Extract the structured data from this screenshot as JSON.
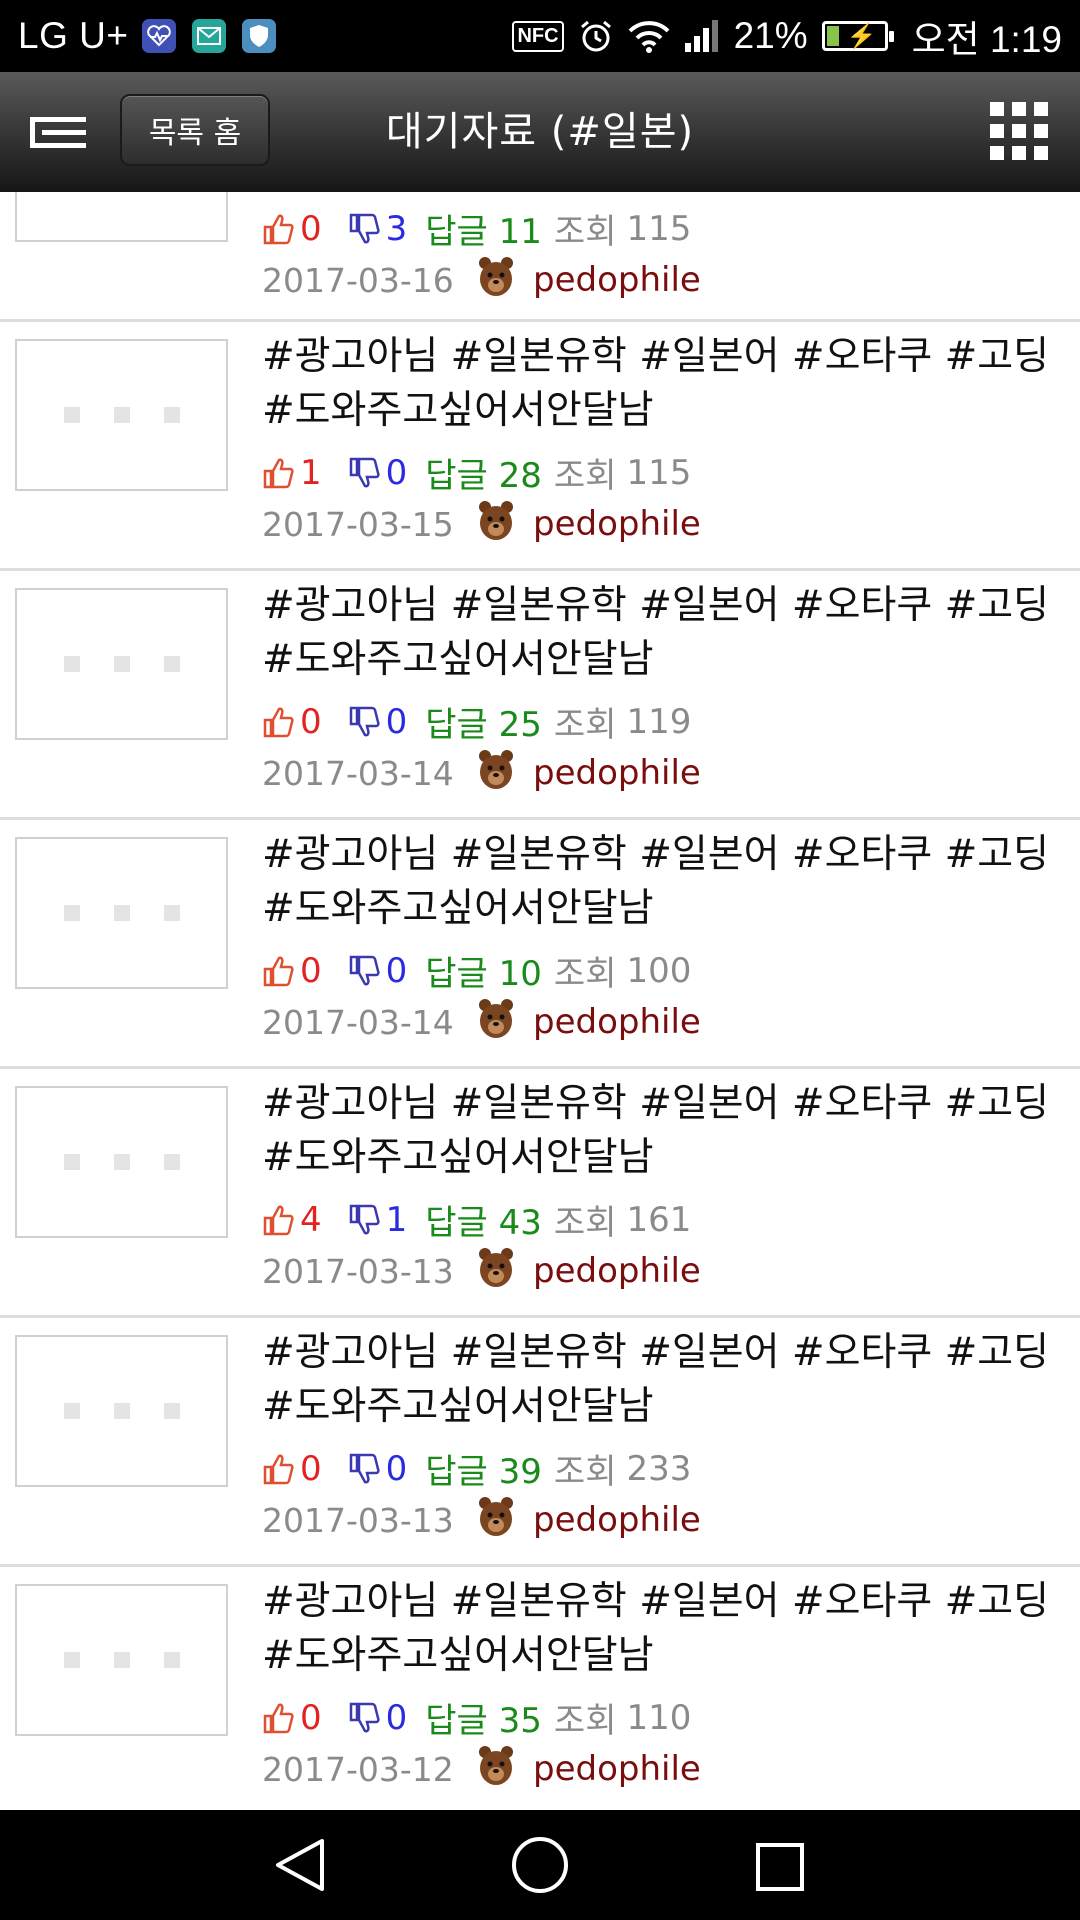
{
  "status_bar": {
    "carrier": "LG U+",
    "app_icons": [
      "health-icon",
      "mail-icon",
      "shield-icon"
    ],
    "nfc": "NFC",
    "battery_percent": "21%",
    "battery_level": 0.21,
    "clock": "오전 1:19"
  },
  "header": {
    "home_button": "목록 홈",
    "title": "대기자료 (#일본)"
  },
  "partial_row": {
    "up": "0",
    "down": "3",
    "reply": "답글 11",
    "view_label": "조회",
    "views": "115",
    "date": "2017-03-16",
    "author": "pedophile"
  },
  "posts": [
    {
      "title": "#광고아님 #일본유학 #일본어 #오타쿠 #고딩 #도와주고싶어서안달남",
      "up": "1",
      "down": "0",
      "reply": "답글 28",
      "view_label": "조회",
      "views": "115",
      "date": "2017-03-15",
      "author": "pedophile"
    },
    {
      "title": "#광고아님 #일본유학 #일본어 #오타쿠 #고딩 #도와주고싶어서안달남",
      "up": "0",
      "down": "0",
      "reply": "답글 25",
      "view_label": "조회",
      "views": "119",
      "date": "2017-03-14",
      "author": "pedophile"
    },
    {
      "title": "#광고아님 #일본유학 #일본어 #오타쿠 #고딩 #도와주고싶어서안달남",
      "up": "0",
      "down": "0",
      "reply": "답글 10",
      "view_label": "조회",
      "views": "100",
      "date": "2017-03-14",
      "author": "pedophile"
    },
    {
      "title": "#광고아님 #일본유학 #일본어 #오타쿠 #고딩 #도와주고싶어서안달남",
      "up": "4",
      "down": "1",
      "reply": "답글 43",
      "view_label": "조회",
      "views": "161",
      "date": "2017-03-13",
      "author": "pedophile"
    },
    {
      "title": "#광고아님 #일본유학 #일본어 #오타쿠 #고딩 #도와주고싶어서안달남",
      "up": "0",
      "down": "0",
      "reply": "답글 39",
      "view_label": "조회",
      "views": "233",
      "date": "2017-03-13",
      "author": "pedophile"
    },
    {
      "title": "#광고아님 #일본유학 #일본어 #오타쿠 #고딩 #도와주고싶어서안달남",
      "up": "0",
      "down": "0",
      "reply": "답글 35",
      "view_label": "조회",
      "views": "110",
      "date": "2017-03-12",
      "author": "pedophile"
    }
  ],
  "colors": {
    "up": "#e02424",
    "down": "#2a2ae0",
    "reply": "#1a8a1a",
    "views": "#8a8a8a",
    "author": "#7a0e0e"
  },
  "nav": {
    "icons": [
      "back-icon",
      "home-circle-icon",
      "recents-icon"
    ]
  }
}
